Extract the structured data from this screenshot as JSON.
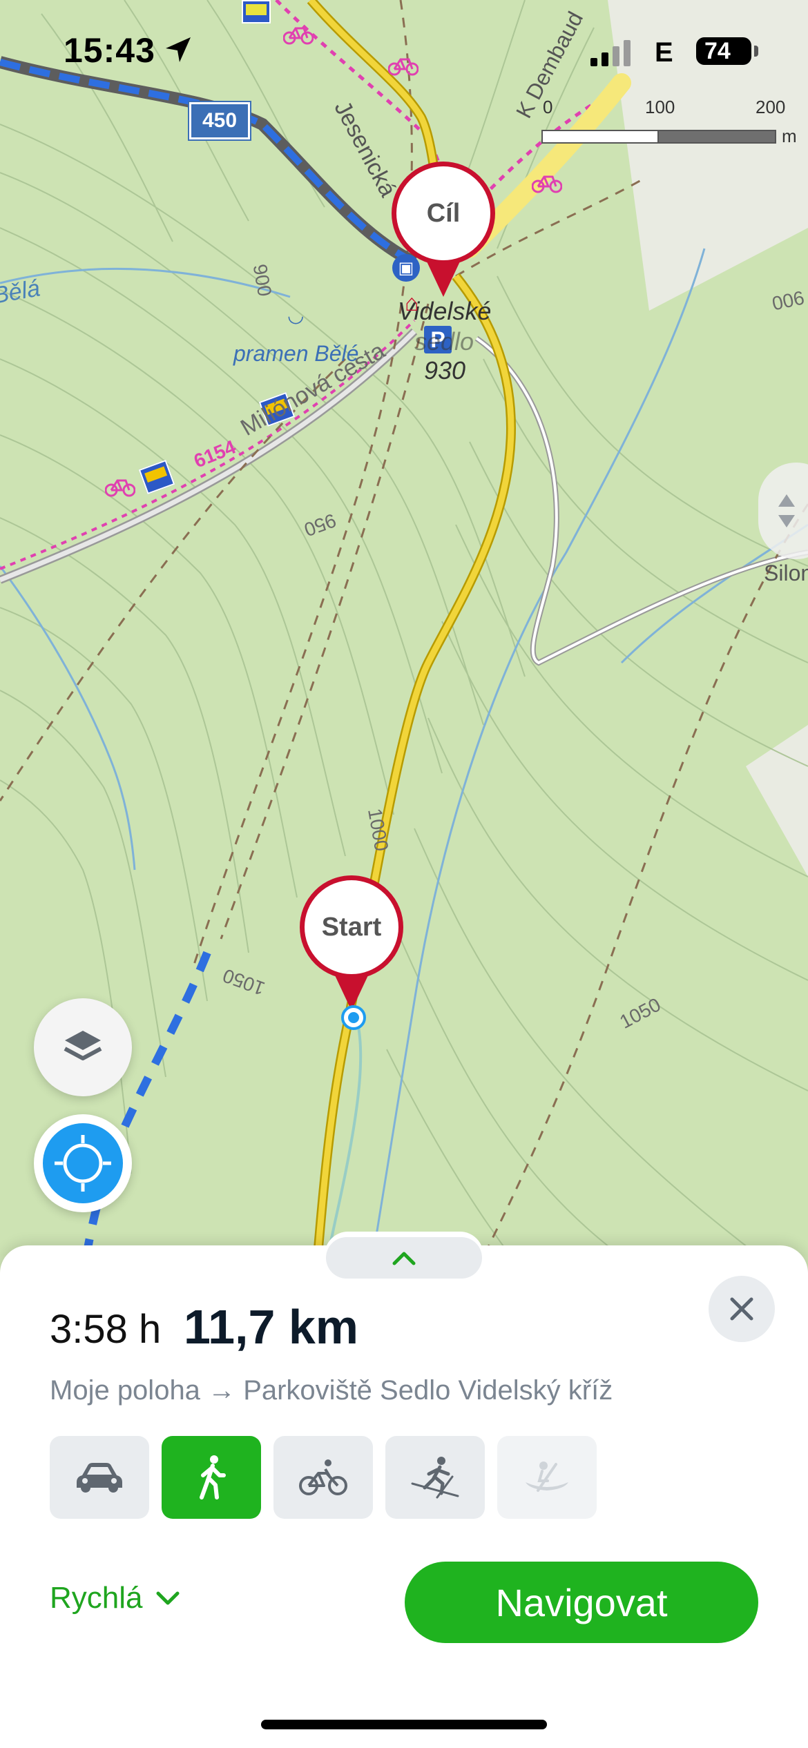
{
  "status_bar": {
    "time": "15:43",
    "network": "E",
    "battery": "74"
  },
  "map": {
    "scale": {
      "labels": [
        "0",
        "100",
        "200"
      ],
      "unit": "m"
    },
    "road_number": "450",
    "trail_number": "6154",
    "place_labels": {
      "bela": "Bělá",
      "pramen_bele": "pramen Bělé",
      "milionova_cesta": "Miliónová cesta",
      "videlske_sedlo_1": "Videlské",
      "videlske_sedlo_2": "sedlo",
      "saddle_elevation": "930",
      "jesenicka": "Jesenická",
      "k_dembaud": "K Dembaud",
      "silon": "Silon"
    },
    "contour_labels": [
      "900",
      "950",
      "1000",
      "1050",
      "1050",
      "006"
    ],
    "pins": {
      "destination": "Cíl",
      "start": "Start"
    }
  },
  "sheet": {
    "duration": "3:58 h",
    "distance": "11,7 km",
    "route_from": "Moje poloha",
    "route_arrow": "→",
    "route_to": "Parkoviště Sedlo Videlský kříž",
    "modes": [
      {
        "icon": "car-icon",
        "active": false
      },
      {
        "icon": "walking-icon",
        "active": true
      },
      {
        "icon": "bicycle-icon",
        "active": false
      },
      {
        "icon": "skiing-icon",
        "active": false
      },
      {
        "icon": "canoe-icon",
        "active": false,
        "disabled": true
      }
    ],
    "route_type": "Rychlá",
    "navigate_label": "Navigovat"
  },
  "colors": {
    "accent_green": "#1fb31f",
    "pin_red": "#c8102e",
    "map_green": "#cfe4b6",
    "road_yellow": "#e8c81a",
    "location_blue": "#1e9cf0"
  }
}
